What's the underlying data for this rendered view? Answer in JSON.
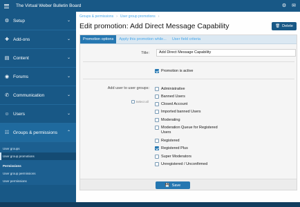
{
  "app": {
    "title": "The Virtual Weber Bulletin Board"
  },
  "topbar_icons": [
    "settings-icon",
    "notifications-icon"
  ],
  "sidebar": {
    "sections": [
      {
        "label": "Setup",
        "icon": "gear-icon"
      },
      {
        "label": "Add-ons",
        "icon": "puzzle-icon"
      },
      {
        "label": "Content",
        "icon": "document-icon"
      },
      {
        "label": "Forums",
        "icon": "forums-icon"
      },
      {
        "label": "Communication",
        "icon": "chat-icon"
      },
      {
        "label": "Users",
        "icon": "user-icon"
      },
      {
        "label": "Groups & permissions",
        "icon": "groups-icon"
      }
    ],
    "sub_items": {
      "group1": [
        "User groups",
        "User group promotions"
      ],
      "permissions_head": "Permissions",
      "group2": [
        "User group permissions",
        "User permissions"
      ]
    }
  },
  "breadcrumb": [
    "Groups & permissions",
    "User group promotions"
  ],
  "page": {
    "title": "Edit promotion: Add Direct Message Capability",
    "delete_label": "Delete"
  },
  "tabs": [
    "Promotion options",
    "Apply this promotion while...",
    "User field criteria"
  ],
  "form": {
    "title_label": "Title:",
    "title_value": "Add Direct Message Capability",
    "active_label": "Promotion is active",
    "groups_label": "Add user to user groups:",
    "select_all": "Select all",
    "groups": [
      {
        "name": "Administrative",
        "checked": false
      },
      {
        "name": "Banned Users",
        "checked": false
      },
      {
        "name": "Closed Account",
        "checked": false
      },
      {
        "name": "Imported banned Users",
        "checked": false
      },
      {
        "name": "Moderating",
        "checked": false
      },
      {
        "name": "Moderation Queue for Registered Users",
        "checked": false
      },
      {
        "name": "Registered",
        "checked": false
      },
      {
        "name": "Registered Plus",
        "checked": true
      },
      {
        "name": "Super Moderators",
        "checked": false
      },
      {
        "name": "Unregistered / Unconfirmed",
        "checked": false
      }
    ],
    "save_label": "Save"
  },
  "colors": {
    "brand": "#185886",
    "accent": "#2577b1",
    "link": "#47a7eb"
  }
}
